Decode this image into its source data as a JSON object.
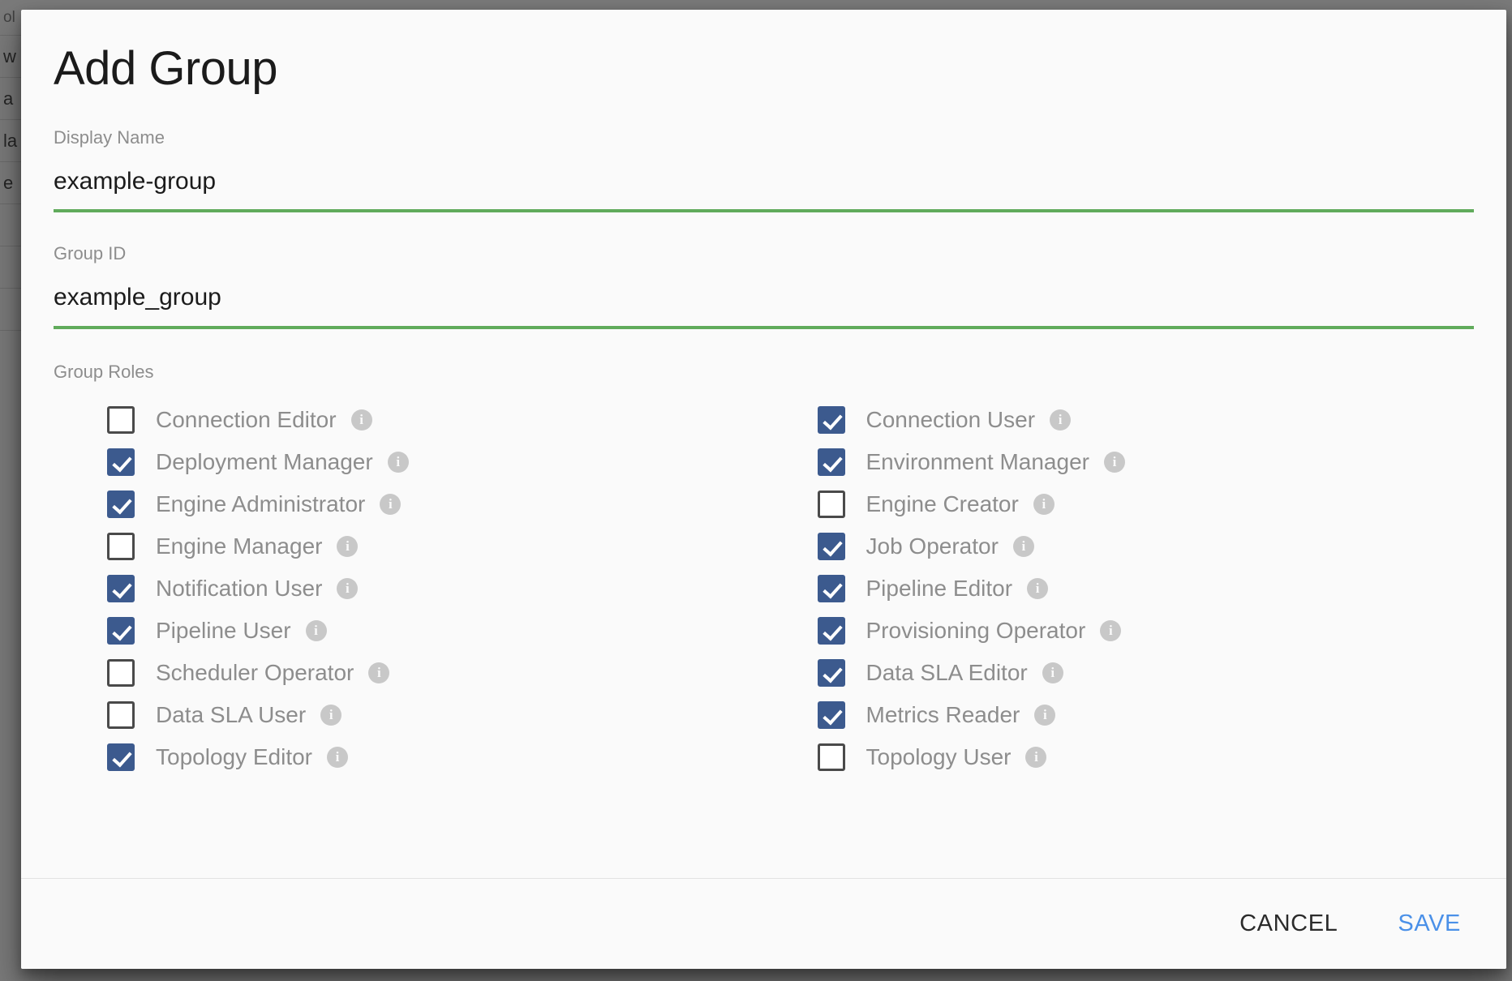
{
  "background": {
    "table_rows": [
      {
        "text": "ol"
      },
      {
        "text": "w"
      },
      {
        "text": "a"
      },
      {
        "text": "la"
      },
      {
        "text": "e"
      },
      {
        "text": ""
      },
      {
        "text": ""
      },
      {
        "text": ""
      }
    ]
  },
  "dialog": {
    "title": "Add Group",
    "fields": [
      {
        "label": "Display Name",
        "value": "example-group",
        "placeholder": "Display Name",
        "underline_color": "#60ab5b"
      },
      {
        "label": "Group ID",
        "value": "example_group",
        "placeholder": "Group ID",
        "underline_color": "#60ab5b"
      }
    ],
    "roles": {
      "label": "Group Roles",
      "info_icon": "info-icon",
      "info_glyph": "i",
      "checked_color": "#3c5a8e",
      "unchecked_border_color": "#4a4a4a",
      "left_column": [
        {
          "label": "Connection Editor",
          "checked": false
        },
        {
          "label": "Deployment Manager",
          "checked": true
        },
        {
          "label": "Engine Administrator",
          "checked": true
        },
        {
          "label": "Engine Manager",
          "checked": false
        },
        {
          "label": "Notification User",
          "checked": true
        },
        {
          "label": "Pipeline User",
          "checked": true
        },
        {
          "label": "Scheduler Operator",
          "checked": false
        },
        {
          "label": "Data SLA User",
          "checked": false
        },
        {
          "label": "Topology Editor",
          "checked": true
        }
      ],
      "right_column": [
        {
          "label": "Connection User",
          "checked": true
        },
        {
          "label": "Environment Manager",
          "checked": true
        },
        {
          "label": "Engine Creator",
          "checked": false
        },
        {
          "label": "Job Operator",
          "checked": true
        },
        {
          "label": "Pipeline Editor",
          "checked": true
        },
        {
          "label": "Provisioning Operator",
          "checked": true
        },
        {
          "label": "Data SLA Editor",
          "checked": true
        },
        {
          "label": "Metrics Reader",
          "checked": true
        },
        {
          "label": "Topology User",
          "checked": false
        }
      ]
    },
    "footer": {
      "cancel_label": "CANCEL",
      "save_label": "SAVE",
      "save_color": "#4a90e8",
      "cancel_color": "#2b2b2b"
    }
  }
}
